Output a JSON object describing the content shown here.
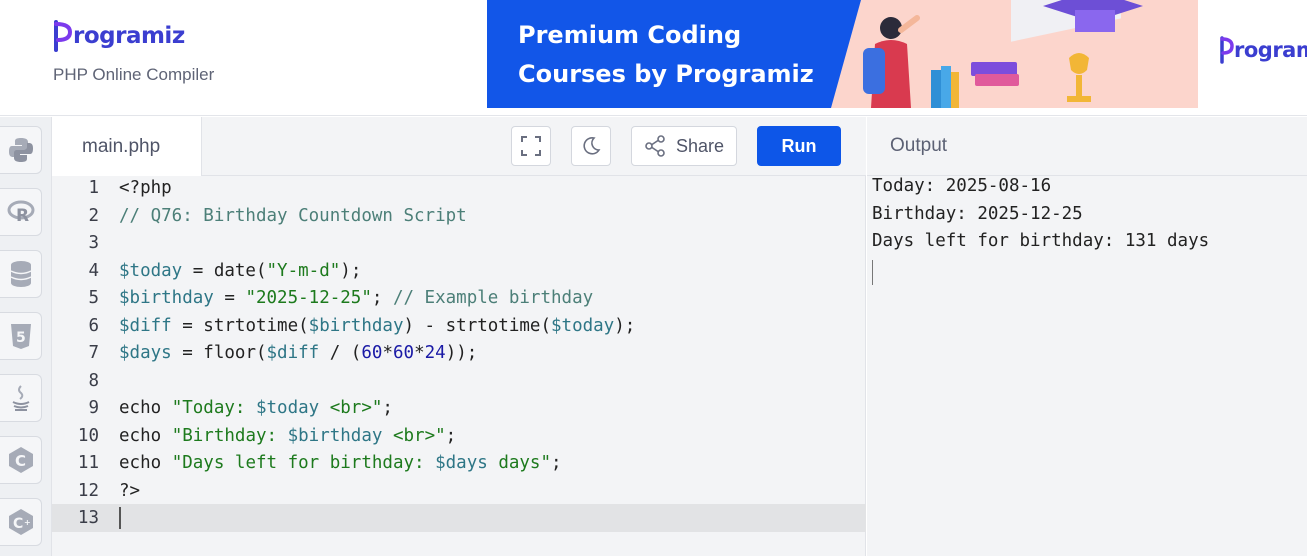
{
  "header": {
    "logo_text": "rogramiz",
    "subtitle": "PHP Online Compiler",
    "banner": {
      "line1": "Premium Coding",
      "line2": "Courses by Programiz",
      "bg_color": "#1256e8"
    },
    "banner2_logo_text": "rogram"
  },
  "sidebar": {
    "items": [
      {
        "icon": "python-icon"
      },
      {
        "icon": "r-language-icon"
      },
      {
        "icon": "database-icon"
      },
      {
        "icon": "html5-icon"
      },
      {
        "icon": "java-icon"
      },
      {
        "icon": "c-language-icon"
      },
      {
        "icon": "cpp-language-icon"
      }
    ]
  },
  "editor": {
    "filename": "main.php",
    "share_label": "Share",
    "run_label": "Run",
    "accent_color": "#0d56e8",
    "line_numbers": [
      "1",
      "2",
      "3",
      "4",
      "5",
      "6",
      "7",
      "8",
      "9",
      "10",
      "11",
      "12",
      "13"
    ],
    "active_line": 13,
    "lines": [
      [
        {
          "t": "<?php",
          "c": "plain"
        }
      ],
      [
        {
          "t": "// Q76: Birthday Countdown Script",
          "c": "com"
        }
      ],
      [],
      [
        {
          "t": "$today",
          "c": "var"
        },
        {
          "t": " = date(",
          "c": "plain"
        },
        {
          "t": "\"Y-m-d\"",
          "c": "str"
        },
        {
          "t": ");",
          "c": "plain"
        }
      ],
      [
        {
          "t": "$birthday",
          "c": "var"
        },
        {
          "t": " = ",
          "c": "plain"
        },
        {
          "t": "\"2025-12-25\"",
          "c": "str"
        },
        {
          "t": "; ",
          "c": "plain"
        },
        {
          "t": "// Example birthday",
          "c": "com"
        }
      ],
      [
        {
          "t": "$diff",
          "c": "var"
        },
        {
          "t": " = strtotime(",
          "c": "plain"
        },
        {
          "t": "$birthday",
          "c": "var"
        },
        {
          "t": ") - strtotime(",
          "c": "plain"
        },
        {
          "t": "$today",
          "c": "var"
        },
        {
          "t": ");",
          "c": "plain"
        }
      ],
      [
        {
          "t": "$days",
          "c": "var"
        },
        {
          "t": " = floor(",
          "c": "plain"
        },
        {
          "t": "$diff",
          "c": "var"
        },
        {
          "t": " / (",
          "c": "plain"
        },
        {
          "t": "60",
          "c": "num"
        },
        {
          "t": "*",
          "c": "plain"
        },
        {
          "t": "60",
          "c": "num"
        },
        {
          "t": "*",
          "c": "plain"
        },
        {
          "t": "24",
          "c": "num"
        },
        {
          "t": "));",
          "c": "plain"
        }
      ],
      [],
      [
        {
          "t": "echo ",
          "c": "plain"
        },
        {
          "t": "\"Today: ",
          "c": "str"
        },
        {
          "t": "$today",
          "c": "var"
        },
        {
          "t": " <br>\"",
          "c": "str"
        },
        {
          "t": ";",
          "c": "plain"
        }
      ],
      [
        {
          "t": "echo ",
          "c": "plain"
        },
        {
          "t": "\"Birthday: ",
          "c": "str"
        },
        {
          "t": "$birthday",
          "c": "var"
        },
        {
          "t": " <br>\"",
          "c": "str"
        },
        {
          "t": ";",
          "c": "plain"
        }
      ],
      [
        {
          "t": "echo ",
          "c": "plain"
        },
        {
          "t": "\"Days left for birthday: ",
          "c": "str"
        },
        {
          "t": "$days",
          "c": "var"
        },
        {
          "t": " days\"",
          "c": "str"
        },
        {
          "t": ";",
          "c": "plain"
        }
      ],
      [
        {
          "t": "?>",
          "c": "plain"
        }
      ],
      []
    ]
  },
  "output": {
    "title": "Output",
    "lines": [
      "Today: 2025-08-16",
      "Birthday: 2025-12-25",
      "Days left for birthday: 131 days"
    ]
  }
}
